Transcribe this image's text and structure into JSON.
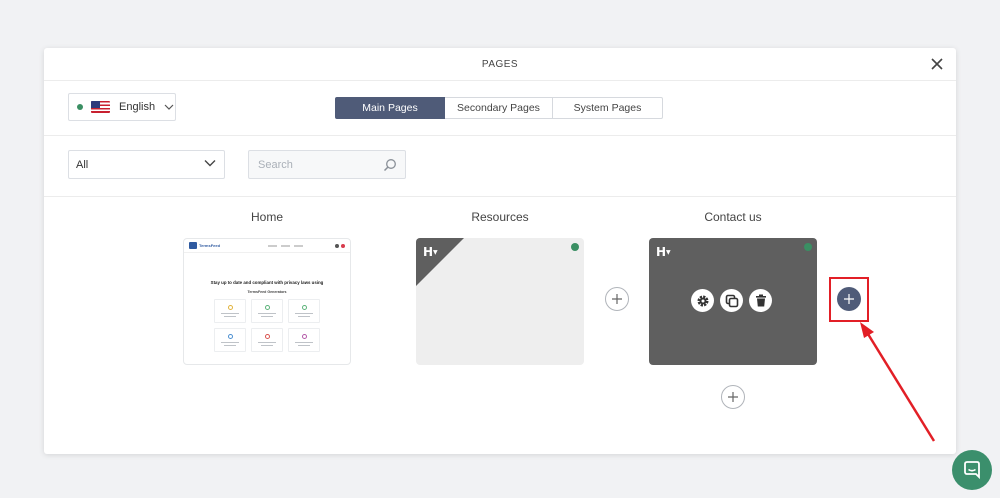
{
  "modal": {
    "title": "PAGES"
  },
  "language": {
    "label": "English",
    "status_color": "#3a8f63"
  },
  "tabs": [
    {
      "label": "Main Pages",
      "active": true
    },
    {
      "label": "Secondary Pages",
      "active": false
    },
    {
      "label": "System Pages",
      "active": false
    }
  ],
  "filter": {
    "selected": "All"
  },
  "search": {
    "placeholder": "Search"
  },
  "pages": [
    {
      "name": "Home"
    },
    {
      "name": "Resources"
    },
    {
      "name": "Contact us"
    }
  ],
  "home_preview": {
    "brand": "TermsFeed",
    "headline": "Stay up to date and compliant with privacy laws using",
    "subheadline": "TermsFeed Generators"
  },
  "colors": {
    "accent": "#4f5b78",
    "published": "#3a8f63",
    "highlight": "#e21f26",
    "chat": "#3b8f6c"
  }
}
